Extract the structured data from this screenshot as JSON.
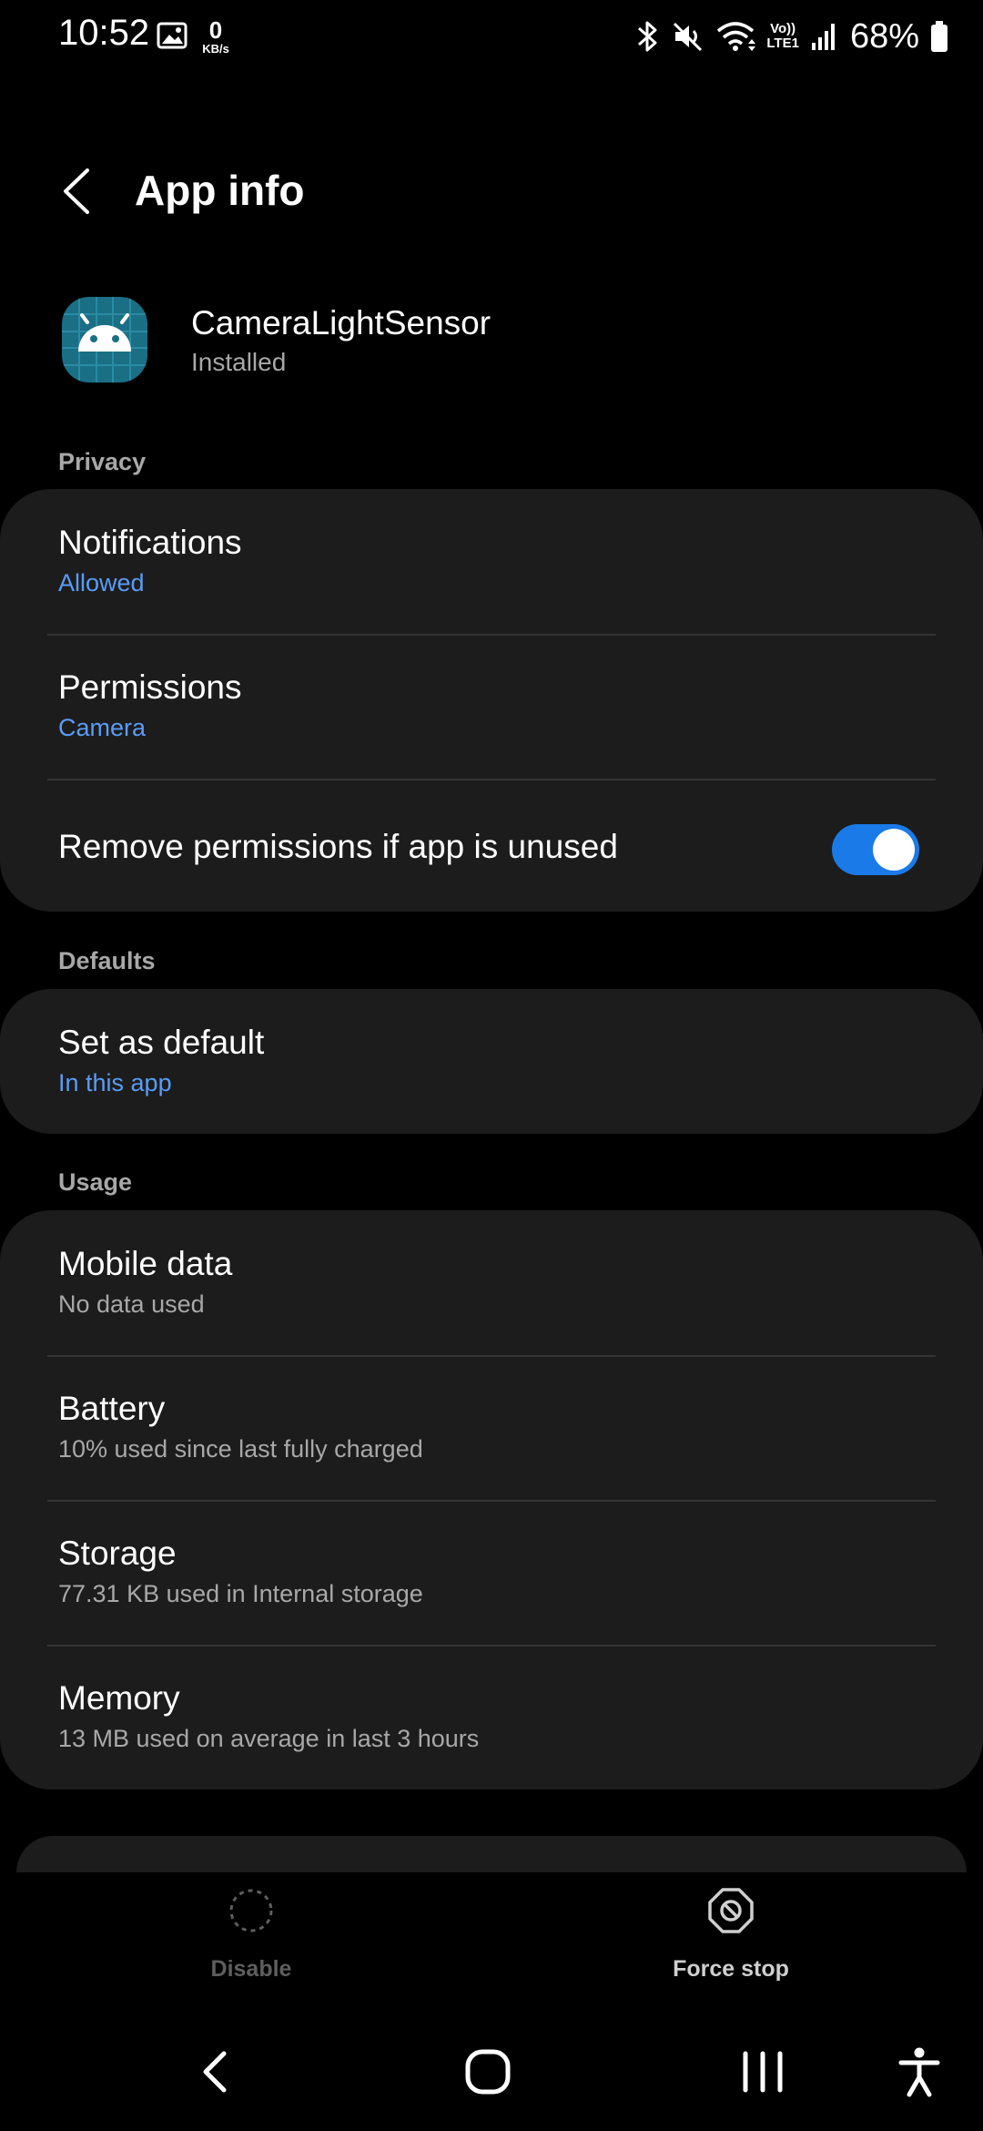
{
  "status_bar": {
    "time": "10:52",
    "net_speed_value": "0",
    "net_speed_unit": "KB/s",
    "volte_top": "Vo))",
    "volte_bottom": "LTE1",
    "battery_percent": "68%",
    "icons": [
      "gallery-icon",
      "bluetooth-icon",
      "mute-icon",
      "wifi-icon",
      "signal-icon",
      "battery-icon"
    ]
  },
  "app_bar": {
    "title": "App info"
  },
  "app": {
    "name": "CameraLightSensor",
    "status": "Installed",
    "icon_color": "#1a6f85"
  },
  "sections": {
    "privacy": {
      "label": "Privacy",
      "notifications": {
        "title": "Notifications",
        "subtitle": "Allowed"
      },
      "permissions": {
        "title": "Permissions",
        "subtitle": "Camera"
      },
      "remove_permissions": {
        "title": "Remove permissions if app is unused",
        "enabled": true
      }
    },
    "defaults": {
      "label": "Defaults",
      "set_as_default": {
        "title": "Set as default",
        "subtitle": "In this app"
      }
    },
    "usage": {
      "label": "Usage",
      "mobile_data": {
        "title": "Mobile data",
        "subtitle": "No data used"
      },
      "battery": {
        "title": "Battery",
        "subtitle": "10% used since last fully charged"
      },
      "storage": {
        "title": "Storage",
        "subtitle": "77.31 KB used in Internal storage"
      },
      "memory": {
        "title": "Memory",
        "subtitle": "13 MB used on average in last 3 hours"
      }
    }
  },
  "bottom_actions": {
    "disable": {
      "label": "Disable",
      "enabled": false
    },
    "force_stop": {
      "label": "Force stop",
      "enabled": true
    }
  },
  "colors": {
    "background": "#000000",
    "card": "#1c1c1c",
    "accent": "#5a9cf6",
    "toggle_on": "#1a7ae8"
  }
}
